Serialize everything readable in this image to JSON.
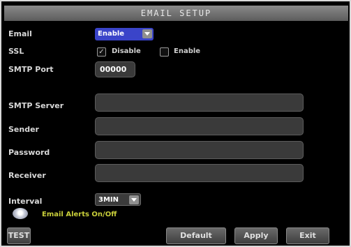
{
  "title": "EMAIL SETUP",
  "rows": {
    "email_label": "Email",
    "ssl_label": "SSL",
    "smtp_port_label": "SMTP Port",
    "smtp_server_label": "SMTP Server",
    "sender_label": "Sender",
    "password_label": "Password",
    "receiver_label": "Receiver",
    "interval_label": "Interval"
  },
  "email_select": "Enable",
  "ssl": {
    "disable_label": "Disable",
    "enable_label": "Enable",
    "disable_checked": true,
    "enable_checked": false
  },
  "smtp_port_value": "00000",
  "smtp_server_value": "",
  "sender_value": "",
  "password_value": "",
  "receiver_value": "",
  "interval_select": "3MIN",
  "alerts_label": "Email Alerts On/Off",
  "buttons": {
    "test": "TEST",
    "default": "Default",
    "apply": "Apply",
    "exit": "Exit"
  },
  "colors": {
    "accent_select": "#3a44c9",
    "alerts_text": "#c9cf3a"
  },
  "icons": {
    "alerts_toggle": "eye-icon",
    "dropdown": "chevron-down-icon",
    "checkbox": "check-icon"
  }
}
